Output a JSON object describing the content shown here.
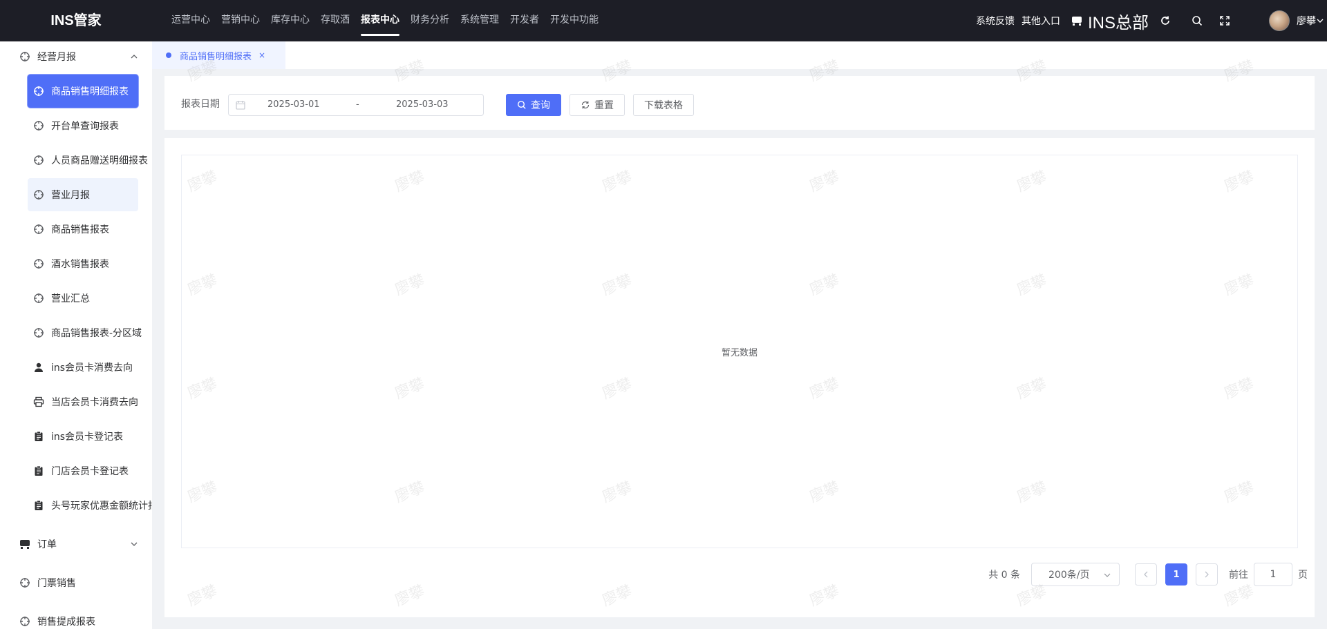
{
  "app": {
    "logo": "INS管家"
  },
  "nav": [
    {
      "label": "运营中心",
      "active": false
    },
    {
      "label": "营销中心",
      "active": false
    },
    {
      "label": "库存中心",
      "active": false
    },
    {
      "label": "存取酒",
      "active": false
    },
    {
      "label": "报表中心",
      "active": true
    },
    {
      "label": "财务分析",
      "active": false
    },
    {
      "label": "系统管理",
      "active": false
    },
    {
      "label": "开发者",
      "active": false
    },
    {
      "label": "开发中功能",
      "active": false
    }
  ],
  "header_right": {
    "feedback": "系统反馈",
    "other_entry": "其他入口",
    "store_name": "INS总部",
    "user_name": "廖攀"
  },
  "sidebar": {
    "group_monthly": "经营月报",
    "items": [
      {
        "label": "商品销售明细报表",
        "icon": "crosshair-icon",
        "state": "active"
      },
      {
        "label": "开台单查询报表",
        "icon": "crosshair-icon",
        "state": ""
      },
      {
        "label": "人员商品赠送明细报表",
        "icon": "crosshair-icon",
        "state": ""
      },
      {
        "label": "营业月报",
        "icon": "crosshair-icon",
        "state": "hover"
      },
      {
        "label": "商品销售报表",
        "icon": "crosshair-icon",
        "state": ""
      },
      {
        "label": "酒水销售报表",
        "icon": "crosshair-icon",
        "state": ""
      },
      {
        "label": "营业汇总",
        "icon": "crosshair-icon",
        "state": ""
      },
      {
        "label": "商品销售报表-分区域",
        "icon": "crosshair-icon",
        "state": ""
      },
      {
        "label": "ins会员卡消费去向",
        "icon": "user-icon",
        "state": ""
      },
      {
        "label": "当店会员卡消费去向",
        "icon": "printer-icon",
        "state": ""
      },
      {
        "label": "ins会员卡登记表",
        "icon": "clipboard-icon",
        "state": ""
      },
      {
        "label": "门店会员卡登记表",
        "icon": "clipboard-icon",
        "state": ""
      },
      {
        "label": "头号玩家优惠金额统计报",
        "icon": "clipboard-icon",
        "state": ""
      }
    ],
    "group_orders": "订单",
    "group_tickets": "门票销售",
    "group_commission": "销售提成报表"
  },
  "tabs": [
    {
      "label": "商品销售明细报表",
      "close": "×"
    }
  ],
  "filter": {
    "label": "报表日期",
    "start_date": "2025-03-01",
    "separator": "-",
    "end_date": "2025-03-03",
    "query": "查询",
    "reset": "重置",
    "download": "下载表格"
  },
  "table": {
    "empty_text": "暂无数据"
  },
  "pagination": {
    "total": "共 0 条",
    "page_size": "200条/页",
    "current_page": "1",
    "goto_label": "前往",
    "goto_value": "1",
    "page_suffix": "页"
  },
  "watermark": "廖攀",
  "colors": {
    "accent": "#4f6ef7",
    "topbar": "#1d1e26",
    "hover_bg": "#eef3fd"
  }
}
